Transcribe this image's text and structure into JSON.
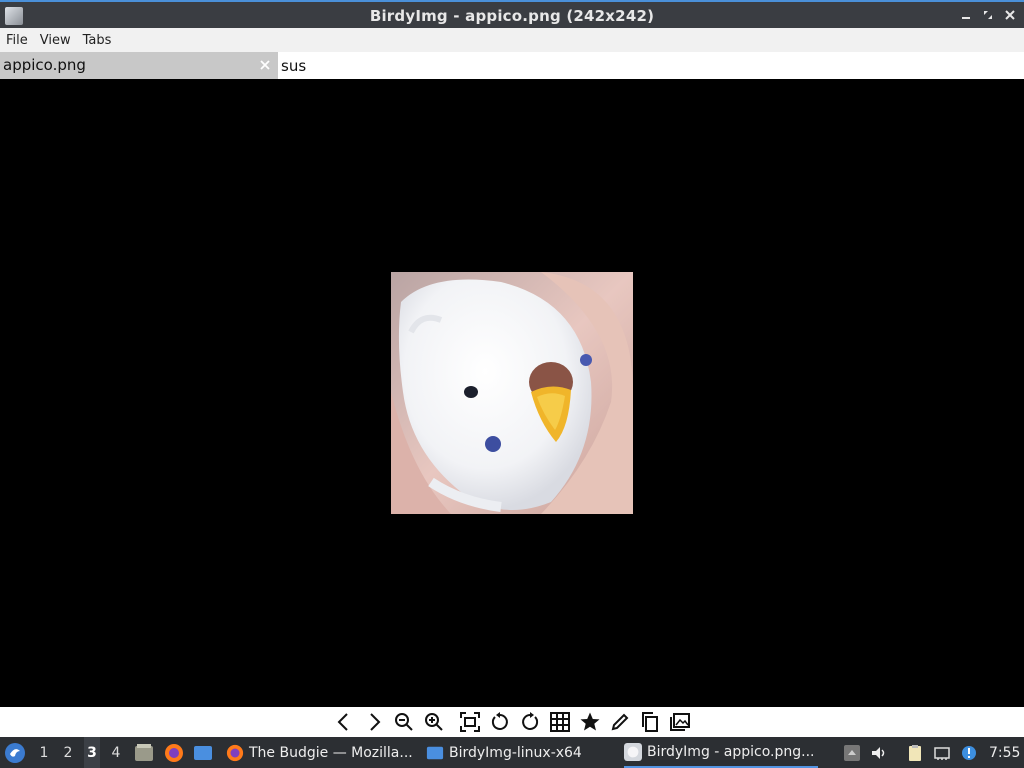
{
  "window": {
    "title": "BirdyImg - appico.png (242x242)",
    "icons": {
      "app": "birdyimg-app-icon",
      "minimize": "minimize-icon",
      "maximize": "maximize-icon",
      "close": "close-icon"
    }
  },
  "menu": {
    "items": [
      {
        "label": "File"
      },
      {
        "label": "View"
      },
      {
        "label": "Tabs"
      }
    ]
  },
  "tabs": {
    "active_label": "appico.png",
    "input_value": "sus"
  },
  "image": {
    "filename": "appico.png",
    "description_icon": "budgie-bird-photo"
  },
  "toolbar": {
    "tools": [
      {
        "name": "previous-icon"
      },
      {
        "name": "next-icon"
      },
      {
        "name": "zoom-out-icon"
      },
      {
        "name": "zoom-in-icon"
      },
      {
        "name": "fit-to-window-icon"
      },
      {
        "name": "rotate-left-icon"
      },
      {
        "name": "rotate-right-icon"
      },
      {
        "name": "grid-icon"
      },
      {
        "name": "star-icon"
      },
      {
        "name": "edit-pencil-icon"
      },
      {
        "name": "copy-icon"
      },
      {
        "name": "gallery-icon"
      }
    ]
  },
  "taskbar": {
    "workspaces": [
      "1",
      "2",
      "3",
      "4"
    ],
    "active_workspace": "3",
    "tasks": [
      {
        "label": "The Budgie — Mozilla...",
        "icon": "firefox-icon"
      },
      {
        "label": "BirdyImg-linux-x64",
        "icon": "folder-icon"
      },
      {
        "label": "BirdyImg - appico.png...",
        "icon": "birdyimg-app-icon"
      }
    ],
    "clock": "7:55"
  },
  "colors": {
    "titlebar": "#3a3d42",
    "accent": "#4a90d9",
    "taskbar": "#2c2f33",
    "viewer_bg": "#000000"
  }
}
